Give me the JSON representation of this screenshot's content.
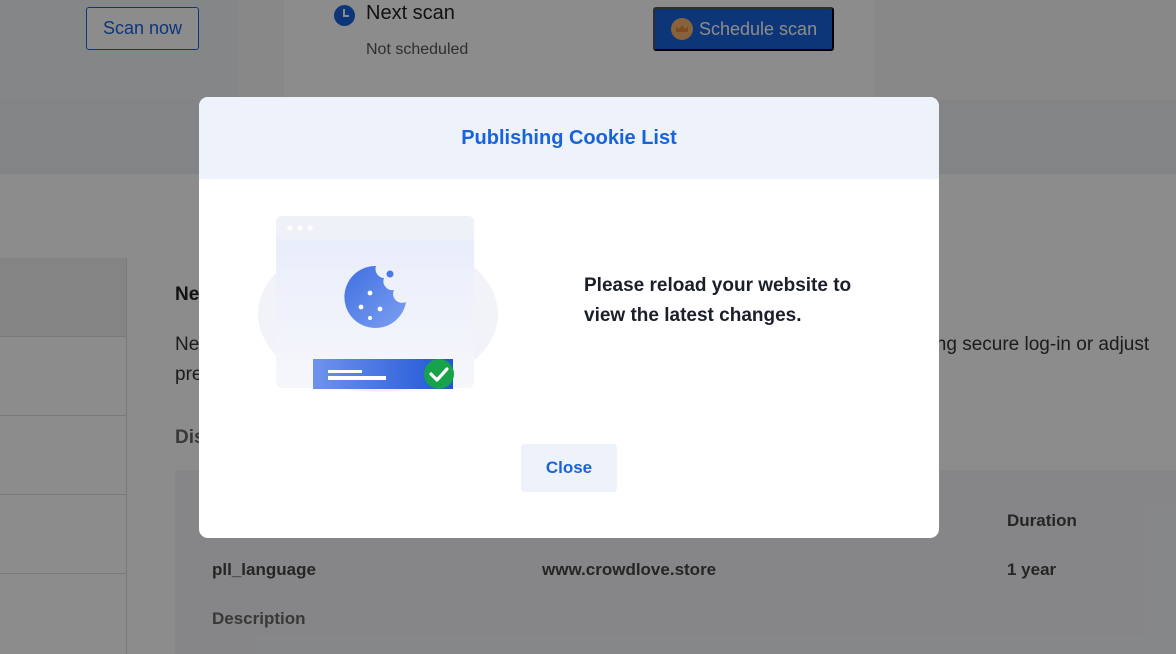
{
  "background": {
    "scan_now_label": "Scan now",
    "next_scan": {
      "title": "Next scan",
      "status": "Not scheduled"
    },
    "schedule_scan_label": "Schedule scan",
    "category": {
      "title_partial": "Ne",
      "desc_line1_partial": "Ne",
      "desc_line2_partial": "pre",
      "desc_right_partial": "ding secure log-in or adjust",
      "section_partial": "Dis"
    },
    "table": {
      "headers": {
        "duration": "Duration"
      },
      "rows": [
        {
          "name": "pll_language",
          "domain": "www.crowdlove.store",
          "duration": "1 year"
        }
      ],
      "description_label": "Description"
    }
  },
  "modal": {
    "title": "Publishing Cookie List",
    "message": "Please reload your website to view the latest changes.",
    "close_label": "Close",
    "illustration_icon": "cookie-browser-check-icon"
  },
  "colors": {
    "accent": "#1863dc",
    "modal_header_bg": "#edf2fb",
    "success": "#16a34a"
  }
}
